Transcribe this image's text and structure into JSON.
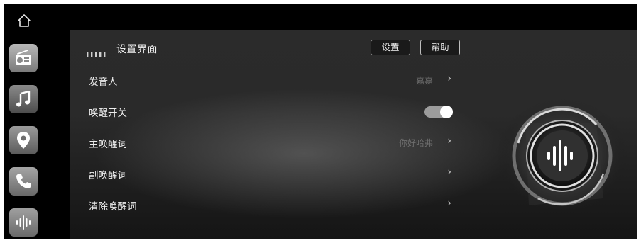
{
  "dock": {
    "home_icon": "home-icon",
    "apps": [
      {
        "name": "radio",
        "icon": "radio-icon"
      },
      {
        "name": "music",
        "icon": "music-note-icon"
      },
      {
        "name": "navigation",
        "icon": "location-pin-icon"
      },
      {
        "name": "phone",
        "icon": "phone-icon"
      },
      {
        "name": "voice",
        "icon": "voice-wave-icon"
      }
    ]
  },
  "header": {
    "title": "设置界面",
    "settings_button": "设置",
    "help_button": "帮助"
  },
  "settings": {
    "rows": [
      {
        "label": "发音人",
        "value": "嘉嘉",
        "control": "chevron"
      },
      {
        "label": "唤醒开关",
        "value": "",
        "control": "toggle",
        "toggle_on": true
      },
      {
        "label": "主唤醒词",
        "value": "你好哈弗",
        "control": "chevron"
      },
      {
        "label": "副唤醒词",
        "value": "",
        "control": "chevron"
      },
      {
        "label": "清除唤醒词",
        "value": "",
        "control": "chevron"
      }
    ],
    "chevron": "›"
  },
  "voice_assistant": {
    "icon": "voice-assistant-orb-icon"
  },
  "colors": {
    "background": "#000000",
    "panel": "#2a2a2a",
    "text": "#ededed",
    "muted_value": "#6e6e6e",
    "toggle_track": "#9c9c9c"
  }
}
